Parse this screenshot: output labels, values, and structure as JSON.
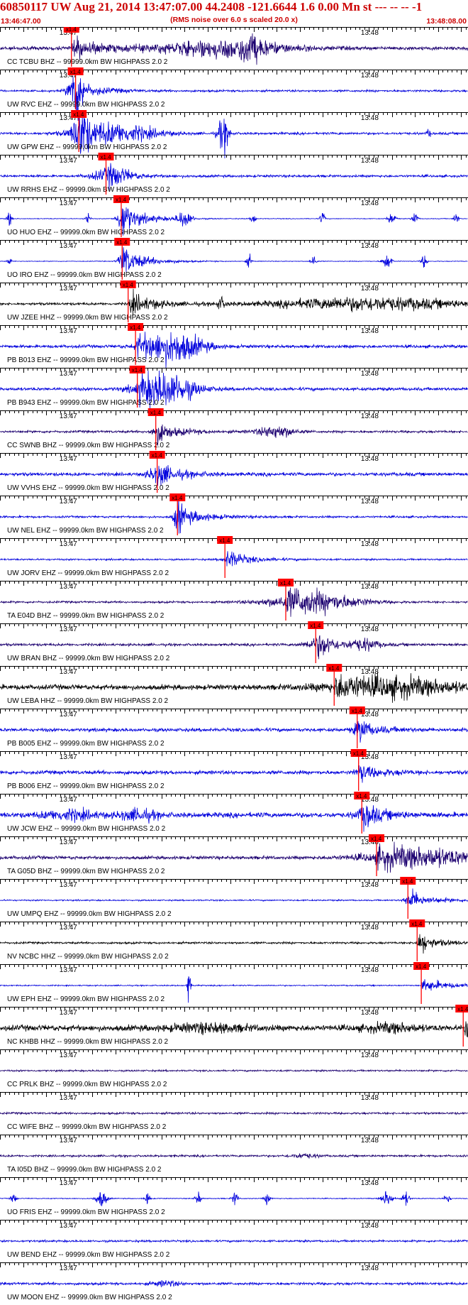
{
  "header": {
    "title": "60850117 UW Aug 21, 2014 13:47:07.00    44.2408 -121.6644  1.6 0.00 Mn st --- -- --   -1",
    "subtitle": "(RMS noise over 6.0 s scaled 20.0 x)",
    "start_time": "13:46:47.00",
    "end_time": "13:48:08.00"
  },
  "colors": {
    "header_text": "#cc0000",
    "pick": "#ff0000",
    "black": "#000000",
    "blue": "#0000dd",
    "navy": "#1c0070",
    "axis": "#000000"
  },
  "chart_data": {
    "type": "line",
    "title": "60850117 UW Aug 21, 2014 13:47:07.00    44.2408 -121.6644  1.6 0.00 Mn st --- -- --   -1",
    "subtitle": "(RMS noise over 6.0 s scaled 20.0 x)",
    "x_range": [
      "13:46:47.00",
      "13:48:08.00"
    ],
    "x_tick_labels": [
      "13:47",
      "13:48"
    ],
    "pick_label": "x1.4",
    "traces": [
      {
        "label": "CC TCBU BHZ -- 99999.0km BW  HIGHPASS  2.0  2",
        "color": "navy",
        "pick_s": 15.5,
        "amp": 1.3,
        "noise": 0.22,
        "env": [
          [
            48,
            14,
            0.9
          ],
          [
            54,
            3,
            1.0
          ]
        ],
        "burst": []
      },
      {
        "label": "UW RVC EHZ -- 99999.0km BW  HIGHPASS  2.0  2",
        "color": "blue",
        "pick_s": 16.4,
        "amp": 1.0,
        "noise": 0.12,
        "env": [],
        "burst": [
          [
            16.5,
            1.5,
            3.2
          ]
        ]
      },
      {
        "label": "UW GPW EHZ -- 99999.0km BW  HIGHPASS  2.0  2",
        "color": "blue",
        "pick_s": 17.1,
        "amp": 1.0,
        "noise": 0.14,
        "env": [
          [
            25,
            9,
            1.0
          ]
        ],
        "burst": [
          [
            17.4,
            1.5,
            2.5
          ],
          [
            48.5,
            1.2,
            2.0
          ],
          [
            93,
            0.4,
            0.5
          ]
        ]
      },
      {
        "label": "UW RRHS EHZ -- 99999.0km BW  HIGHPASS  2.0  2",
        "color": "blue",
        "pick_s": 23.0,
        "amp": 0.7,
        "noise": 0.14,
        "env": [
          [
            24,
            4,
            0.8
          ]
        ],
        "burst": []
      },
      {
        "label": "UO HUO EHZ -- 99999.0km BW  HIGHPASS  2.0  2",
        "color": "blue",
        "pick_s": 26.3,
        "amp": 1.5,
        "noise": 0.04,
        "env": [],
        "burst": [
          [
            2,
            0.5,
            0.9
          ],
          [
            19,
            0.5,
            0.9
          ],
          [
            26.5,
            1.2,
            1.4
          ],
          [
            40,
            1.5,
            1.0
          ],
          [
            55,
            0.5,
            0.8
          ],
          [
            70,
            0.5,
            0.9
          ],
          [
            85,
            0.8,
            0.8
          ],
          [
            90,
            0.6,
            0.8
          ],
          [
            99,
            0.5,
            0.8
          ]
        ]
      },
      {
        "label": "UO IRO EHZ -- 99999.0km BW  HIGHPASS  2.0  2",
        "color": "blue",
        "pick_s": 26.5,
        "amp": 1.5,
        "noise": 0.04,
        "env": [],
        "burst": [
          [
            2,
            0.4,
            0.7
          ],
          [
            26.6,
            1.0,
            1.2
          ],
          [
            54,
            0.5,
            0.8
          ],
          [
            68,
            0.6,
            0.8
          ],
          [
            84,
            1.0,
            0.9
          ],
          [
            92,
            0.6,
            0.8
          ]
        ]
      },
      {
        "label": "UW JZEE HHZ -- 99999.0km BW  HIGHPASS  2.0  2",
        "color": "black",
        "pick_s": 27.8,
        "amp": 1.4,
        "noise": 0.15,
        "env": [
          [
            80,
            20,
            0.75
          ]
        ],
        "burst": [
          [
            48,
            1.0,
            0.6
          ]
        ]
      },
      {
        "label": "PB B013 EHZ -- 99999.0km BW  HIGHPASS  2.0  2",
        "color": "blue",
        "pick_s": 29.4,
        "amp": 1.3,
        "noise": 0.18,
        "env": [
          [
            38,
            6,
            1.6
          ]
        ],
        "burst": []
      },
      {
        "label": "PB B943 EHZ -- 99999.0km BW  HIGHPASS  2.0  2",
        "color": "blue",
        "pick_s": 29.8,
        "amp": 1.3,
        "noise": 0.18,
        "env": [
          [
            36,
            6,
            1.7
          ]
        ],
        "burst": []
      },
      {
        "label": "CC SWNB BHZ -- 99999.0km BW  HIGHPASS  2.0  2",
        "color": "navy",
        "pick_s": 33.8,
        "amp": 1.0,
        "noise": 0.14,
        "env": [
          [
            60,
            4,
            0.7
          ],
          [
            34,
            1.5,
            0.6
          ]
        ],
        "burst": []
      },
      {
        "label": "UW VVHS EHZ -- 99999.0km BW  HIGHPASS  2.0  2",
        "color": "blue",
        "pick_s": 34.1,
        "amp": 1.0,
        "noise": 0.2,
        "env": [
          [
            34,
            2,
            0.8
          ]
        ],
        "burst": []
      },
      {
        "label": "UW NEL EHZ -- 99999.0km BW  HIGHPASS  2.0  2",
        "color": "blue",
        "pick_s": 38.5,
        "amp": 1.2,
        "noise": 0.12,
        "env": [],
        "burst": [
          [
            38.5,
            0.8,
            2.0
          ]
        ]
      },
      {
        "label": "UW JORV EHZ -- 99999.0km BW  HIGHPASS  2.0  2",
        "color": "blue",
        "pick_s": 48.8,
        "amp": 0.9,
        "noise": 0.1,
        "env": [
          [
            50,
            2,
            0.3
          ]
        ],
        "burst": []
      },
      {
        "label": "TA E04D BHZ -- 99999.0km BW  HIGHPASS  2.0  2",
        "color": "navy",
        "pick_s": 62.0,
        "amp": 1.2,
        "noise": 0.12,
        "env": [
          [
            68,
            10,
            1.0
          ]
        ],
        "burst": []
      },
      {
        "label": "UW BRAN BHZ -- 99999.0km BW  HIGHPASS  2.0  2",
        "color": "navy",
        "pick_s": 68.5,
        "amp": 0.9,
        "noise": 0.15,
        "env": [
          [
            69,
            3,
            0.7
          ],
          [
            79,
            3,
            0.6
          ]
        ],
        "burst": []
      },
      {
        "label": "UW LEBA HHZ -- 99999.0km BW  HIGHPASS  2.0  2",
        "color": "black",
        "pick_s": 72.5,
        "amp": 1.3,
        "noise": 0.3,
        "env": [
          [
            86,
            14,
            1.0
          ]
        ],
        "burst": []
      },
      {
        "label": "PB B005 EHZ -- 99999.0km BW  HIGHPASS  2.0  2",
        "color": "blue",
        "pick_s": 77.5,
        "amp": 0.8,
        "noise": 0.2,
        "env": [
          [
            78,
            1.5,
            0.8
          ]
        ],
        "burst": []
      },
      {
        "label": "PB B006 EHZ -- 99999.0km BW  HIGHPASS  2.0  2",
        "color": "blue",
        "pick_s": 77.8,
        "amp": 0.8,
        "noise": 0.22,
        "env": [
          [
            78,
            1,
            0.6
          ]
        ],
        "burst": []
      },
      {
        "label": "UW JCW EHZ -- 99999.0km BW  HIGHPASS  2.0  2",
        "color": "blue",
        "pick_s": 78.5,
        "amp": 1.0,
        "noise": 0.3,
        "env": [
          [
            15,
            6,
            0.5
          ],
          [
            30,
            4,
            0.6
          ],
          [
            79,
            2,
            0.7
          ]
        ],
        "burst": []
      },
      {
        "label": "TA G05D BHZ -- 99999.0km BW  HIGHPASS  2.0  2",
        "color": "navy",
        "pick_s": 81.7,
        "amp": 1.1,
        "noise": 0.2,
        "env": [
          [
            92,
            12,
            1.0
          ]
        ],
        "burst": []
      },
      {
        "label": "UW UMPQ EHZ -- 99999.0km BW  HIGHPASS  2.0  2",
        "color": "blue",
        "pick_s": 88.5,
        "amp": 0.9,
        "noise": 0.08,
        "env": [
          [
            89,
            1.5,
            0.5
          ]
        ],
        "burst": []
      },
      {
        "label": "NV NCBC HHZ -- 99999.0km BW  HIGHPASS  2.0  2",
        "color": "black",
        "pick_s": 90.5,
        "amp": 0.8,
        "noise": 0.12,
        "env": [],
        "burst": [
          [
            91.5,
            1.2,
            0.6
          ]
        ]
      },
      {
        "label": "UW EPH EHZ -- 99999.0km BW  HIGHPASS  2.0  2",
        "color": "blue",
        "pick_s": 91.4,
        "amp": 0.9,
        "noise": 0.07,
        "env": [],
        "burst": [
          [
            41,
            0.3,
            3.0
          ]
        ]
      },
      {
        "label": "NC KHBB HHZ -- 99999.0km BW  HIGHPASS  2.0  2",
        "color": "black",
        "pick_s": 100.5,
        "amp": 1.4,
        "noise": 0.35,
        "env": [
          [
            45,
            8,
            0.4
          ],
          [
            85,
            6,
            0.4
          ]
        ],
        "burst": []
      },
      {
        "label": "CC PRLK BHZ -- 99999.0km BW  HIGHPASS  2.0  2",
        "color": "navy",
        "pick_s": null,
        "amp": 0.8,
        "noise": 0.1,
        "env": [],
        "burst": []
      },
      {
        "label": "CC WIFE BHZ -- 99999.0km BW  HIGHPASS  2.0  2",
        "color": "navy",
        "pick_s": null,
        "amp": 0.8,
        "noise": 0.12,
        "env": [],
        "burst": []
      },
      {
        "label": "TA I05D BHZ -- 99999.0km BW  HIGHPASS  2.0  2",
        "color": "navy",
        "pick_s": null,
        "amp": 0.8,
        "noise": 0.12,
        "env": [
          [
            66,
            3,
            0.25
          ]
        ],
        "burst": []
      },
      {
        "label": "UO FRIS EHZ -- 99999.0km BW  HIGHPASS  2.0  2",
        "color": "blue",
        "pick_s": null,
        "amp": 1.5,
        "noise": 0.05,
        "env": [],
        "burst": [
          [
            3,
            0.6,
            0.6
          ],
          [
            22,
            1.2,
            1.0
          ],
          [
            32,
            0.6,
            0.7
          ],
          [
            43,
            0.6,
            0.8
          ],
          [
            51,
            0.6,
            0.8
          ],
          [
            58,
            0.6,
            0.7
          ],
          [
            84,
            1.2,
            0.9
          ],
          [
            88,
            0.8,
            0.8
          ],
          [
            97,
            0.6,
            0.7
          ]
        ]
      },
      {
        "label": "UW BEND EHZ -- 99999.0km BW  HIGHPASS  2.0  2",
        "color": "blue",
        "pick_s": null,
        "amp": 0.6,
        "noise": 0.12,
        "env": [],
        "burst": []
      },
      {
        "label": "UW MOON EHZ -- 99999.0km BW  HIGHPASS  2.0  2",
        "color": "blue",
        "pick_s": null,
        "amp": 0.6,
        "noise": 0.15,
        "env": [
          [
            36,
            3,
            0.3
          ]
        ],
        "burst": []
      }
    ]
  }
}
